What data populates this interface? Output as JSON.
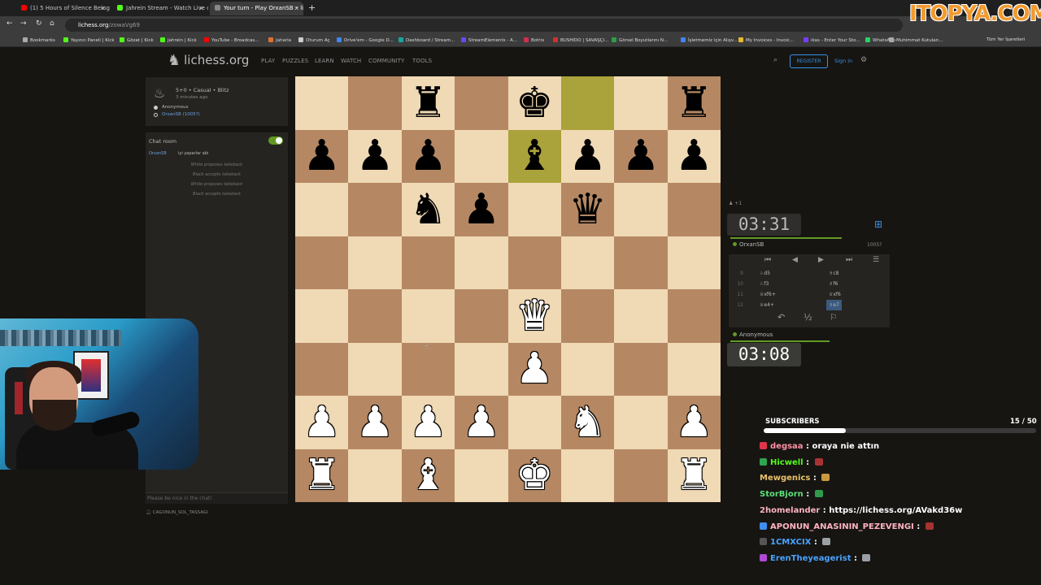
{
  "browser": {
    "tabs": [
      {
        "title": "(1) 5 Hours of Silence Being Ra",
        "fav": "#ff0000"
      },
      {
        "title": "Jahrein Stream - Watch Live on",
        "fav": "#53fc18"
      },
      {
        "title": "Your turn - Play OrxanSB • liche",
        "fav": "#888888"
      }
    ],
    "new_tab": "+",
    "url_host": "lichess.org",
    "url_path": "/zowaVg69",
    "bookmarks": [
      {
        "label": "Bookmarks",
        "color": "#aaaaaa"
      },
      {
        "label": "Yayıncı Paneli | Kick",
        "color": "#53fc18"
      },
      {
        "label": "Gözat | Kick",
        "color": "#53fc18"
      },
      {
        "label": "Jahrein | Kick",
        "color": "#53fc18"
      },
      {
        "label": "YouTube - Broadcas...",
        "color": "#ff0000"
      },
      {
        "label": "Jaharia",
        "color": "#e07030"
      },
      {
        "label": "Oturum Aç",
        "color": "#cccccc"
      },
      {
        "label": "Drive'em - Google D...",
        "color": "#4285f4"
      },
      {
        "label": "Dashboard / Stream...",
        "color": "#1aa3a3"
      },
      {
        "label": "StreamElements - A...",
        "color": "#6b45ff"
      },
      {
        "label": "Botrix",
        "color": "#d03050"
      },
      {
        "label": "BUSHIDO | SAVAŞÇI...",
        "color": "#d03030"
      },
      {
        "label": "Görsel Boyutlarını N...",
        "color": "#2e9d4a"
      },
      {
        "label": "İşletmemiz için Alışv...",
        "color": "#4285f4"
      },
      {
        "label": "My Invoices - Invoic...",
        "color": "#e8b92b"
      },
      {
        "label": "ikas - Enter Your Sto...",
        "color": "#7a3cff"
      },
      {
        "label": "WhatsApp",
        "color": "#25d366"
      },
      {
        "label": "Muhimmat Kutuları...",
        "color": "#aaaaaa"
      }
    ],
    "other_bookmarks": "Tüm Yer İşaretleri"
  },
  "site": {
    "logo": "lichess.org",
    "nav": [
      "PLAY",
      "PUZZLES",
      "LEARN",
      "WATCH",
      "COMMUNITY",
      "TOOLS"
    ],
    "register": "REGISTER",
    "signin": "Sign in"
  },
  "game": {
    "meta": "5+0 • Casual • Blitz",
    "ago": "3 minutes ago",
    "white_player": "Anonymous",
    "black_player": "OrxanSB (1005?)"
  },
  "chat": {
    "title": "Chat room",
    "msg_user": "OrxanSB",
    "msg_text": "iyi yaparlar abi",
    "system": [
      "White proposes takeback",
      "Black accepts takeback",
      "White proposes takeback",
      "Black accepts takeback"
    ],
    "placeholder": "Please be nice in the chat!",
    "spectator": "CAGONUN_SOL_TASSAGI"
  },
  "board": {
    "rows": [
      [
        "",
        "",
        "br",
        "",
        "bk",
        "",
        "",
        "br"
      ],
      [
        "bp",
        "bp",
        "bp",
        "",
        "bb",
        "bp",
        "bp",
        "bp"
      ],
      [
        "",
        "",
        "bn",
        "bp",
        "",
        "bq",
        "",
        ""
      ],
      [
        "",
        "",
        "",
        "",
        "",
        "",
        "",
        ""
      ],
      [
        "",
        "",
        "",
        "",
        "wq",
        "",
        "",
        ""
      ],
      [
        "",
        "",
        "",
        "",
        "wp",
        "",
        "",
        ""
      ],
      [
        "wp",
        "wp",
        "wp",
        "wp",
        "",
        "wn",
        "",
        "wp"
      ],
      [
        "wr",
        "",
        "wb",
        "",
        "wk",
        "",
        "",
        "wr"
      ]
    ],
    "highlight": [
      [
        0,
        5
      ],
      [
        1,
        4
      ]
    ]
  },
  "clocks": {
    "top_player": "OrxanSB",
    "top_rating": "1005?",
    "top_time": "03:31",
    "top_spectators": "+1",
    "bottom_player": "Anonymous",
    "bottom_time": "03:08"
  },
  "moves": [
    {
      "n": "9",
      "w": "♘d5",
      "b": "♗c8"
    },
    {
      "n": "10",
      "w": "♘f3",
      "b": "♗f6"
    },
    {
      "n": "11",
      "w": "♕xf6+",
      "b": "♕xf6"
    },
    {
      "n": "12",
      "w": "♕e4+",
      "b": "♗e7"
    }
  ],
  "overlay": {
    "watermark": "ITOPYA.COM",
    "subs_label": "SUBSCRIBERS",
    "subs_count": "15 / 50",
    "subs_fraction": 0.3,
    "chat": [
      {
        "user": "degsaa",
        "text": "oraya nie attın",
        "color": "#ff8fa3",
        "badge": "#e0344a",
        "emote": ""
      },
      {
        "user": "Hicwell",
        "text": "",
        "color": "#53fc18",
        "badge": "#2ea44f",
        "emote": "#a83232"
      },
      {
        "user": "Mewgenics",
        "text": "",
        "color": "#e8c26a",
        "badge": "",
        "emote": "#c99a3b"
      },
      {
        "user": "StorBjorn",
        "text": "",
        "color": "#5ce07a",
        "badge": "",
        "emote": "#2f9a4a"
      },
      {
        "user": "2homelander",
        "text": "https://lichess.org/AVakd36w",
        "color": "#ffb3c1",
        "badge": "",
        "emote": ""
      },
      {
        "user": "APONUN_ANASININ_PEZEVENGI",
        "text": "",
        "color": "#ffb3c1",
        "badge": "#3f8ff0",
        "emote": "#a83232"
      },
      {
        "user": "1CMXCIX",
        "text": "",
        "color": "#4aa3ff",
        "badge": "#555555",
        "emote": "#9aa0a6"
      },
      {
        "user": "ErenTheyeagerist",
        "text": "",
        "color": "#4aa3ff",
        "badge": "#b04ad6",
        "emote": "#9aa0a6"
      }
    ]
  }
}
